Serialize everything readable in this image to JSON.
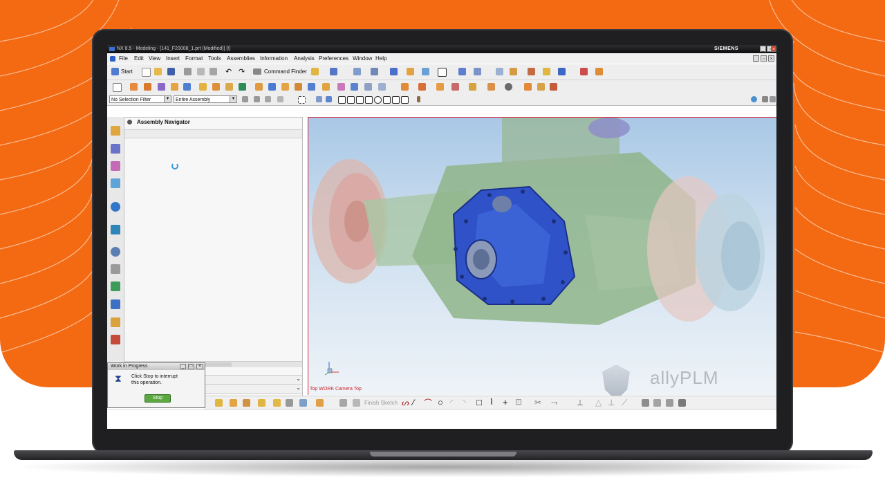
{
  "window": {
    "title": "NX 8.5 - Modeling - [141_F20008_1.prt (Modified)]   [!]",
    "brand": "SIEMENS"
  },
  "menu": [
    "File",
    "Edit",
    "View",
    "Insert",
    "Format",
    "Tools",
    "Assemblies",
    "Information",
    "Analysis",
    "Preferences",
    "Window",
    "Help"
  ],
  "toolbar": {
    "start_label": "Start",
    "command_finder_label": "Command Finder"
  },
  "filterbar": {
    "selection_filter": "No Selection Filter",
    "scope": "Entire Assembly"
  },
  "navigator": {
    "title": "Assembly Navigator"
  },
  "viewport": {
    "view_label": "Top WORK Camera Top"
  },
  "sketch": {
    "finish_label": "Finish Sketch"
  },
  "progress_dialog": {
    "title": "Work in Progress",
    "message_line1": "Click Stop to interrupt",
    "message_line2": "this operation.",
    "stop_label": "Stop"
  },
  "watermark": "allyPLM",
  "colors": {
    "brand_orange": "#f46a12",
    "part_blue": "#2f52c8",
    "housing_green": "#8fb58a",
    "brake_pink": "#d9a5a0"
  }
}
